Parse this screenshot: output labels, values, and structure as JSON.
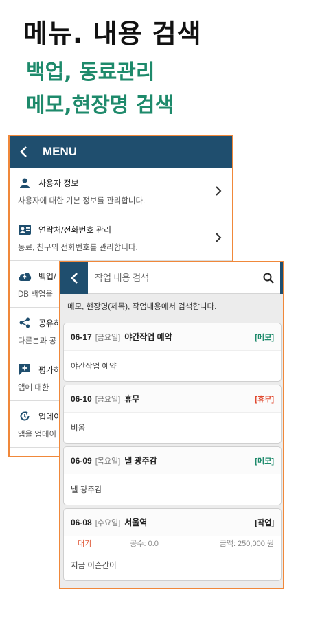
{
  "promo": {
    "headline": "메뉴. 내용 검색",
    "line1": "백업, 동료관리",
    "line2": "메모,현장명 검색"
  },
  "menu": {
    "title": "MENU",
    "items": [
      {
        "title": "사용자 정보",
        "desc": "사용자에 대한 기본 정보를 관리합니다.",
        "icon": "person-icon"
      },
      {
        "title": "연락처/전화번호 관리",
        "desc": "동료, 친구의 전화번호를 관리합니다.",
        "icon": "contact-card-icon"
      },
      {
        "title": "백업/",
        "desc": "DB 백업을",
        "icon": "cloud-upload-icon"
      },
      {
        "title": "공유하",
        "desc": "다른분과 공",
        "icon": "share-icon"
      },
      {
        "title": "평가하",
        "desc": "앱에 대한 ",
        "icon": "rate-icon"
      },
      {
        "title": "업데이",
        "desc": "앱을 업데이",
        "icon": "update-icon"
      }
    ]
  },
  "search": {
    "placeholder": "작업 내용 검색",
    "hint": "메모, 현장명(제목), 작업내용에서 검색합니다.",
    "results": [
      {
        "date": "06-17",
        "day": "[금요일]",
        "title": "야간작업 예약",
        "tag": "[메모]",
        "tag_color": "#1e8a6b",
        "body": "야간작업 예약"
      },
      {
        "date": "06-10",
        "day": "[금요일]",
        "title": "휴무",
        "tag": "[휴무]",
        "tag_color": "#e0492f",
        "body": "비옴"
      },
      {
        "date": "06-09",
        "day": "[목요일]",
        "title": "낼 광주감",
        "tag": "[메모]",
        "tag_color": "#1e8a6b",
        "body": "낼 광주감"
      },
      {
        "date": "06-08",
        "day": "[수요일]",
        "title": "서울역",
        "tag": "[작업]",
        "tag_color": "#222222",
        "status": "대기",
        "gongsu": "공수: 0.0",
        "amount": "금액: 250,000 원",
        "body": "지금 이슨간이"
      }
    ]
  },
  "colors": {
    "accent_green": "#1e8a6b",
    "header_navy": "#1f4e6e",
    "frame_orange": "#f0883a"
  }
}
